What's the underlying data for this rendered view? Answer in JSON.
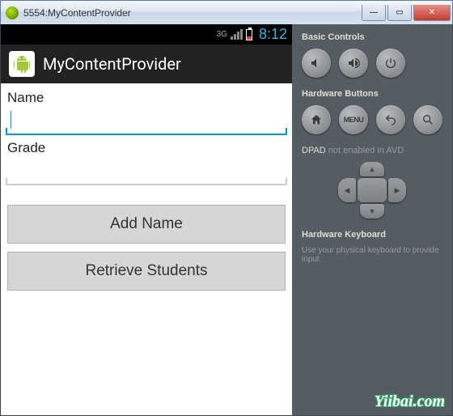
{
  "window": {
    "title": "5554:MyContentProvider"
  },
  "statusbar": {
    "network": "3G",
    "time": "8:12"
  },
  "actionbar": {
    "app_title": "MyContentProvider"
  },
  "form": {
    "name_label": "Name",
    "name_value": "",
    "grade_label": "Grade",
    "grade_value": ""
  },
  "buttons": {
    "add_name": "Add Name",
    "retrieve": "Retrieve Students"
  },
  "panel": {
    "basic_heading": "Basic Controls",
    "hardware_heading": "Hardware Buttons",
    "menu_label": "MENU",
    "dpad_heading": "DPAD",
    "dpad_muted": "not enabled in AVD",
    "kb_heading": "Hardware Keyboard",
    "kb_desc": "Use your physical keyboard to provide input"
  },
  "watermark": "Yiibai.com"
}
